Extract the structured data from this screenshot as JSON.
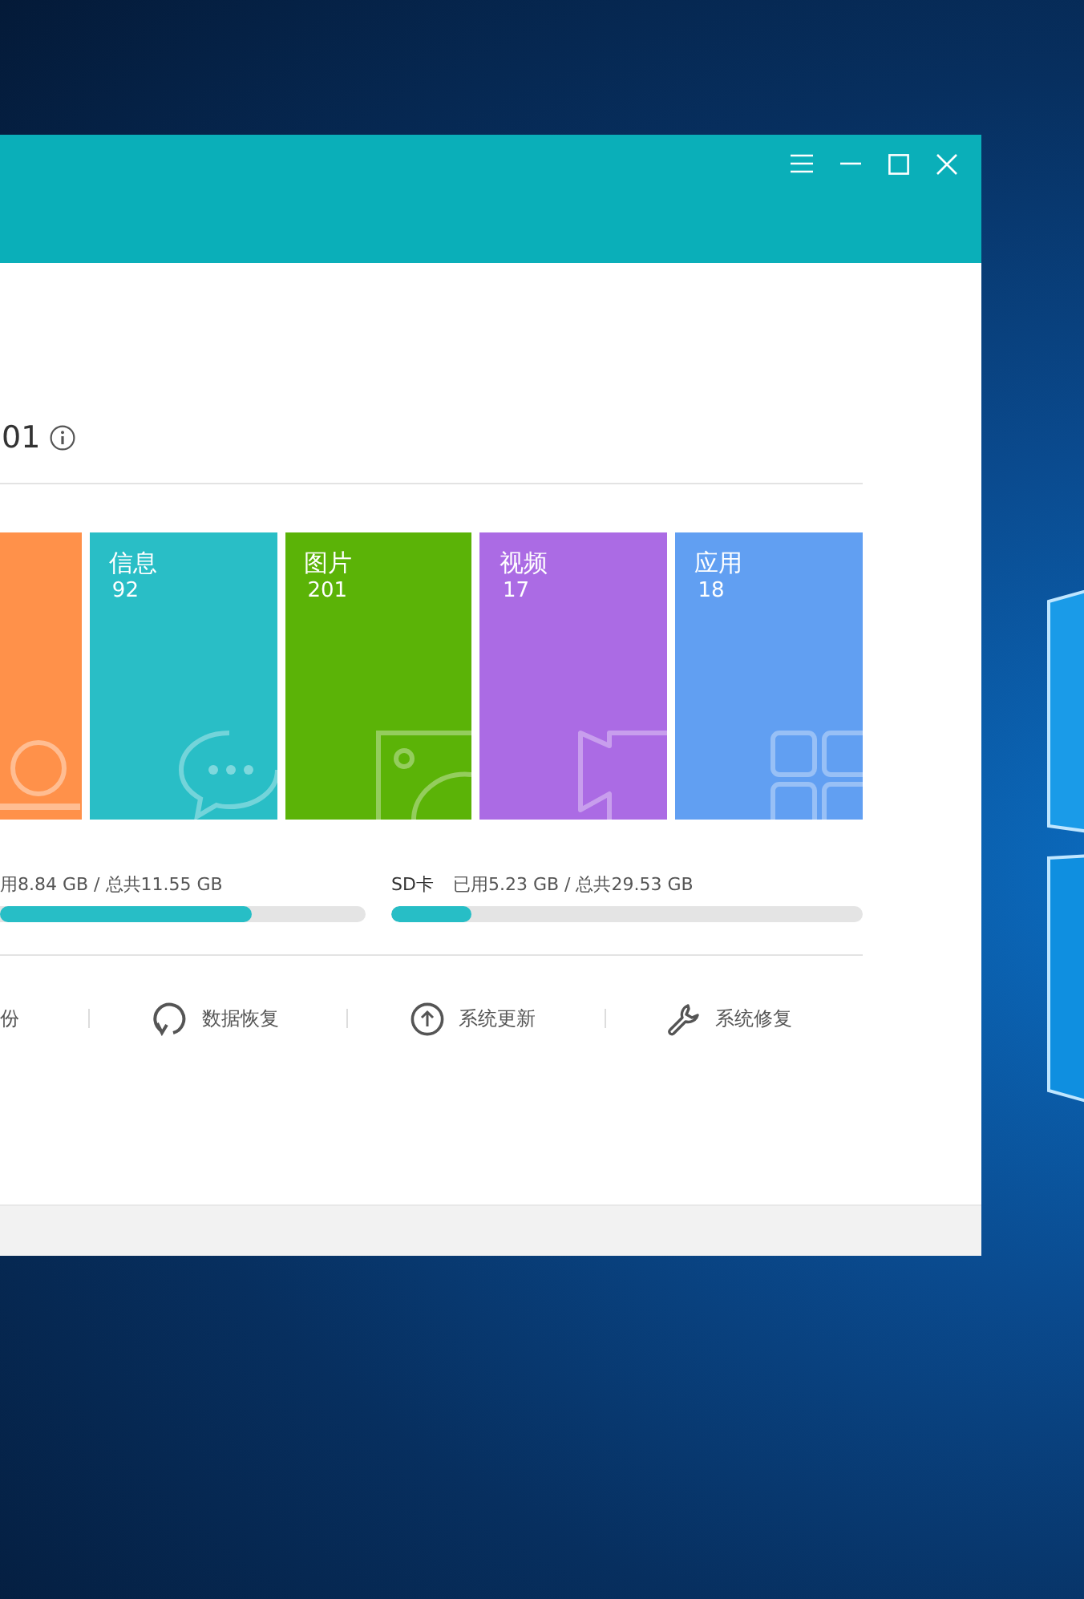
{
  "window": {
    "controls": [
      {
        "kind": "menu"
      },
      {
        "kind": "minimize"
      },
      {
        "kind": "maximize"
      },
      {
        "kind": "close"
      }
    ]
  },
  "device": {
    "name_tail": "01"
  },
  "tiles": [
    {
      "color": "#ff914a",
      "kind": "contacts"
    },
    {
      "label": "信息",
      "count": "92",
      "color": "#29bec6",
      "kind": "messages"
    },
    {
      "label": "图片",
      "count": "201",
      "color": "#5bb307",
      "kind": "photos"
    },
    {
      "label": "视频",
      "count": "17",
      "color": "#ab6be4",
      "kind": "videos"
    },
    {
      "label": "应用",
      "count": "18",
      "color": "#619ff2",
      "kind": "apps"
    }
  ],
  "storage": [
    {
      "usage": "用8.84 GB / 总共11.55 GB",
      "level": 0.69
    },
    {
      "label": "SD卡",
      "usage": "已用5.23 GB / 总共29.53 GB",
      "level": 0.17
    }
  ],
  "actions": [
    {
      "label": "份",
      "kind": "backup"
    },
    {
      "label": "数据恢复",
      "kind": "restore"
    },
    {
      "label": "系统更新",
      "kind": "update"
    },
    {
      "label": "系统修复",
      "kind": "repair"
    }
  ]
}
